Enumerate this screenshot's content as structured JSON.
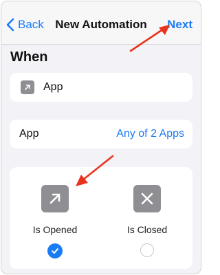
{
  "navbar": {
    "back_label": "Back",
    "title": "New Automation",
    "next_label": "Next"
  },
  "section": {
    "title": "When"
  },
  "trigger_row": {
    "label": "App"
  },
  "apps_row": {
    "label": "App",
    "value": "Any of 2 Apps"
  },
  "options": [
    {
      "label": "Is Opened",
      "selected": true
    },
    {
      "label": "Is Closed",
      "selected": false
    }
  ],
  "colors": {
    "accent": "#1a7cf5",
    "icon_gray": "#8e8e93",
    "annotation_red": "#e8341c"
  }
}
